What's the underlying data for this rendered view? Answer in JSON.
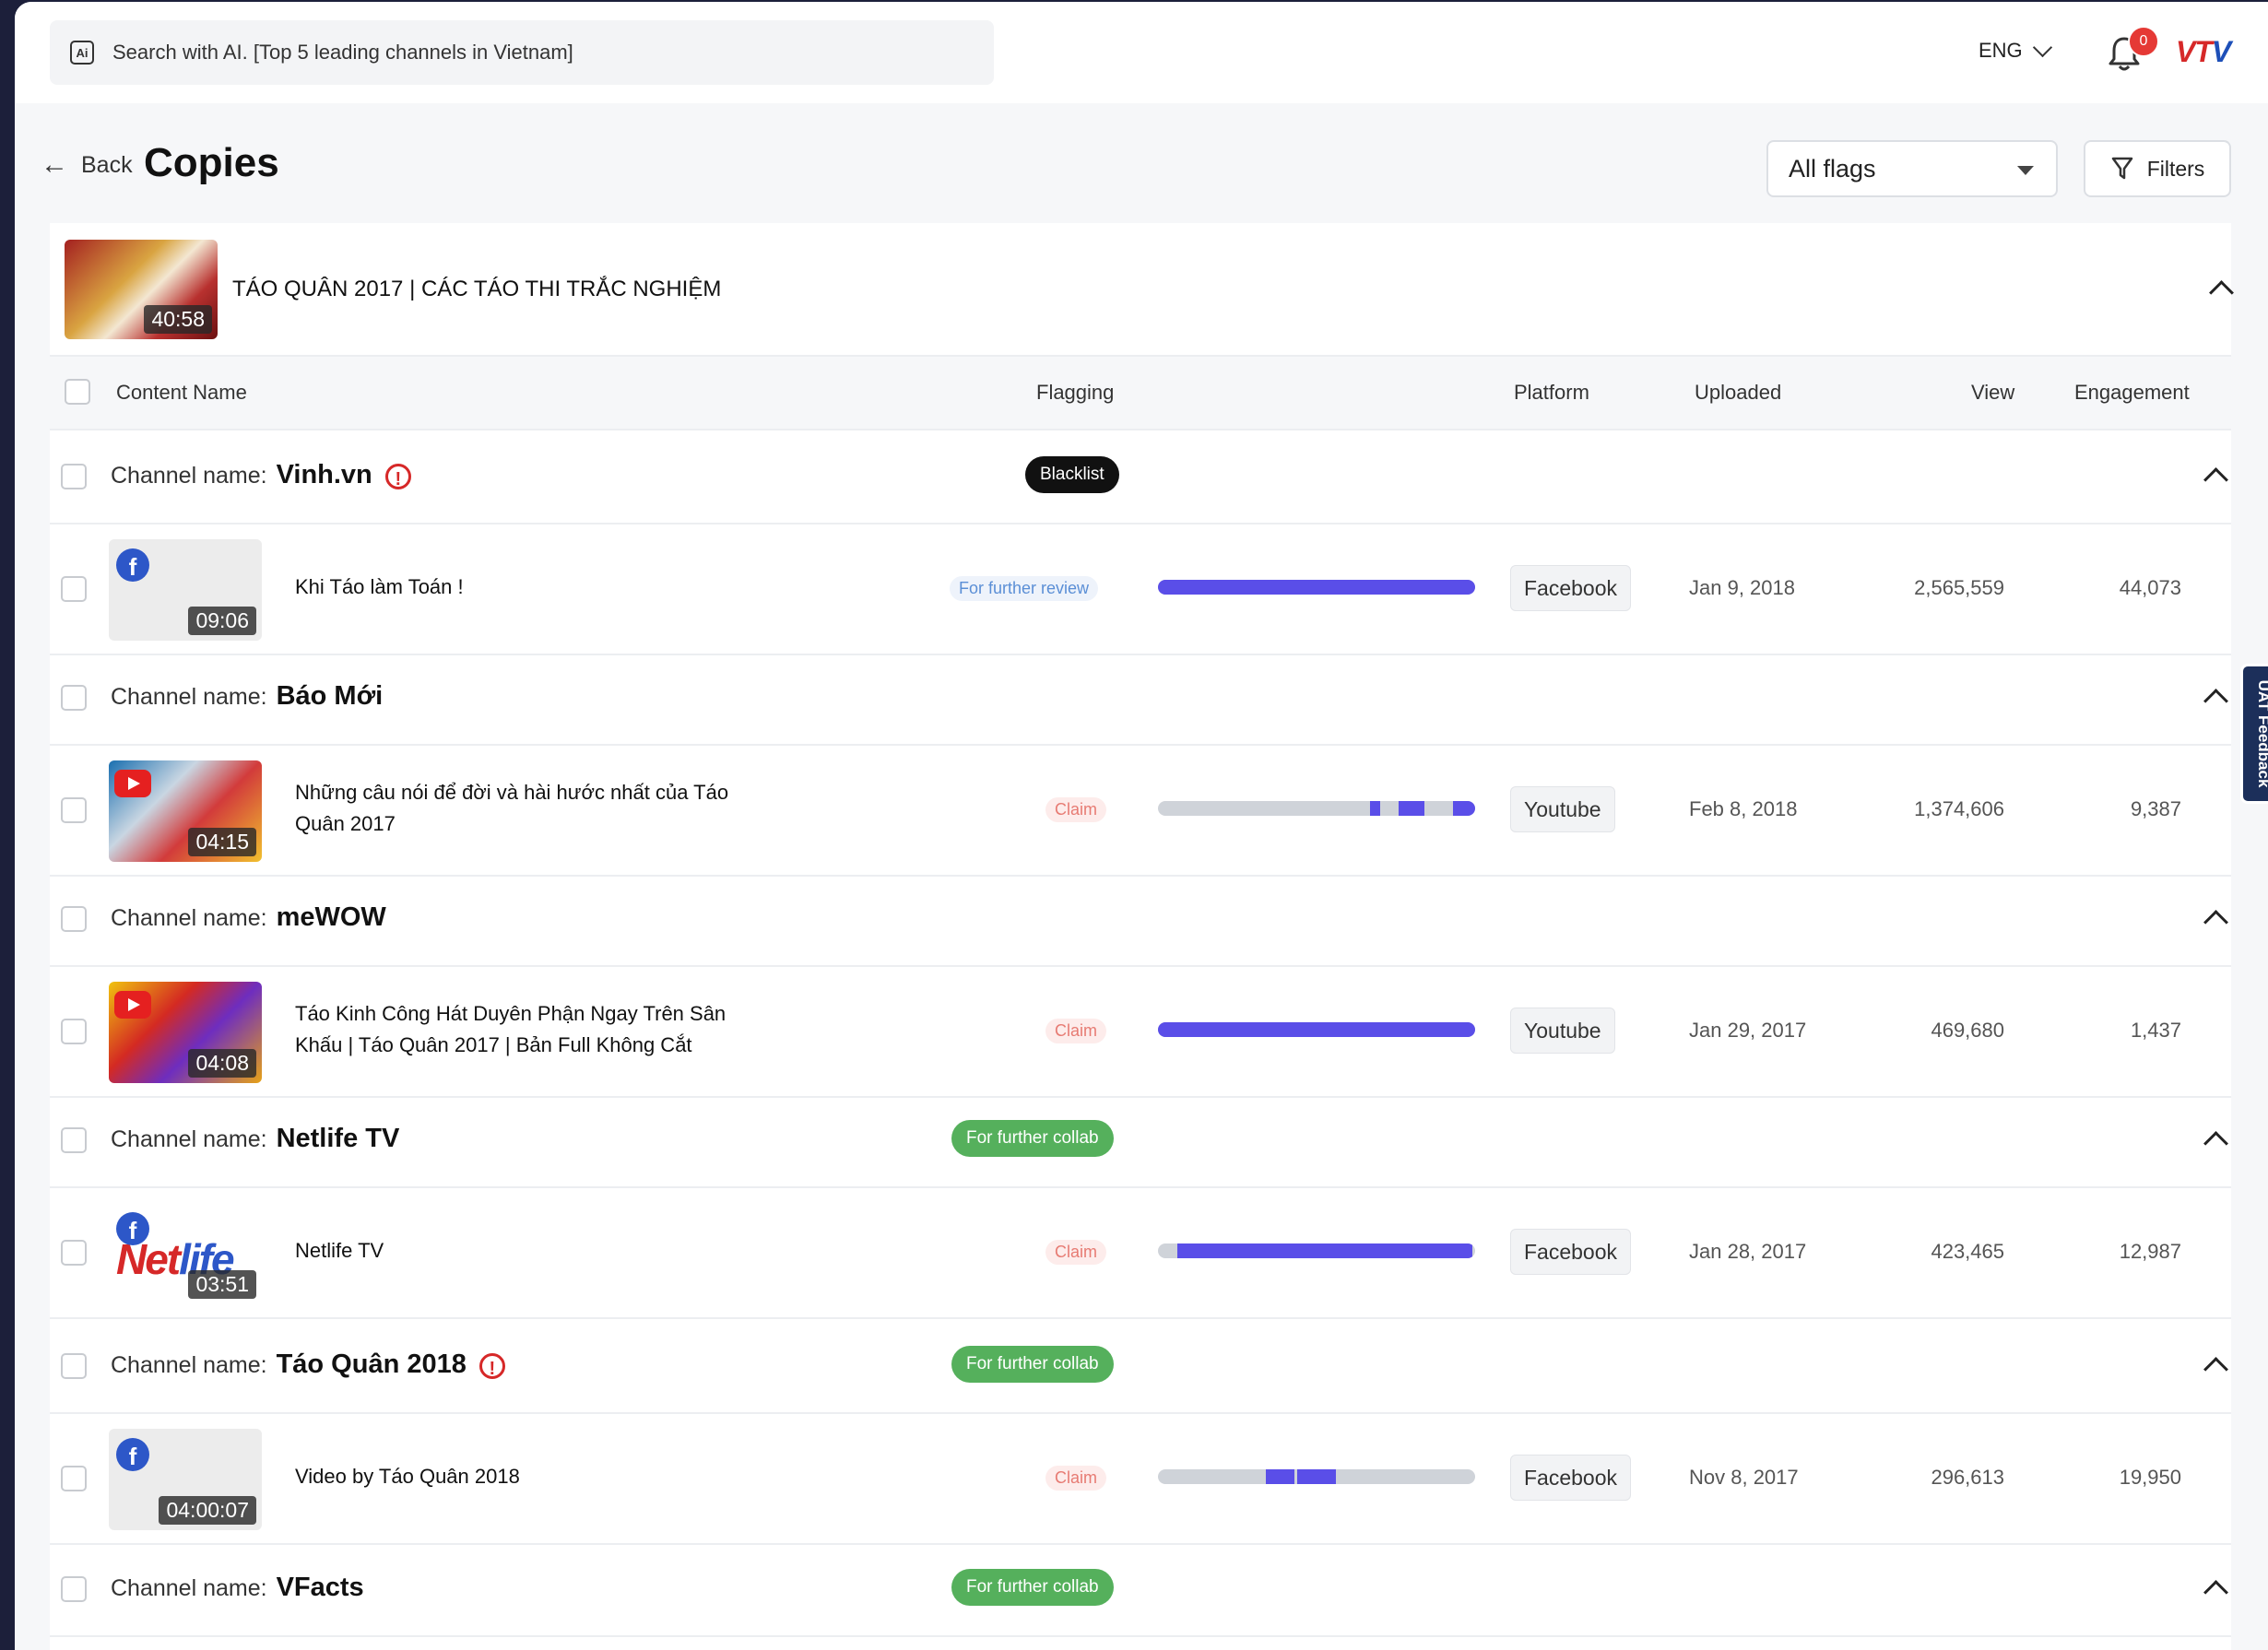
{
  "header": {
    "search_placeholder": "Search with AI. [Top 5 leading channels in Vietnam]",
    "ai_icon_text": "Ai",
    "language": "ENG",
    "notification_count": "0",
    "logo_part1": "VT",
    "logo_part2": "V"
  },
  "page": {
    "back_label": "Back",
    "title": "Copies",
    "flag_filter": "All flags",
    "filters_label": "Filters"
  },
  "source": {
    "title": "TÁO QUÂN 2017 | CÁC TÁO THI TRẮC NGHIỆM",
    "duration": "40:58"
  },
  "columns": {
    "content_name": "Content Name",
    "flagging": "Flagging",
    "platform": "Platform",
    "uploaded": "Uploaded",
    "view": "View",
    "engagement": "Engagement"
  },
  "channel_label": "Channel name:",
  "groups": [
    {
      "channel": "Vinh.vn",
      "warning": true,
      "channel_flag": "Blacklist",
      "flag_style": "black",
      "video": {
        "title": "Khi Táo làm Toán !",
        "title2": "",
        "duration": "09:06",
        "thumb": "fb",
        "status": "For further review",
        "status_style": "review",
        "match_segments": [
          [
            0.0,
            1.0
          ]
        ],
        "platform": "Facebook",
        "uploaded": "Jan 9, 2018",
        "views": "2,565,559",
        "engagement": "44,073"
      }
    },
    {
      "channel": "Báo Mới",
      "warning": false,
      "channel_flag": "",
      "flag_style": "",
      "video": {
        "title": "Những câu nói để đời và hài hước nhất của Táo",
        "title2": "Quân 2017",
        "duration": "04:15",
        "thumb": "yt1",
        "status": "Claim",
        "status_style": "claim",
        "match_segments": [
          [
            0.67,
            0.7
          ],
          [
            0.76,
            0.84
          ],
          [
            0.93,
            1.0
          ]
        ],
        "platform": "Youtube",
        "uploaded": "Feb 8, 2018",
        "views": "1,374,606",
        "engagement": "9,387"
      }
    },
    {
      "channel": "meWOW",
      "warning": false,
      "channel_flag": "",
      "flag_style": "",
      "video": {
        "title": "Táo Kinh Công Hát Duyên Phận Ngay Trên Sân",
        "title2": "Khấu | Táo Quân 2017 | Bản Full Không Cắt",
        "duration": "04:08",
        "thumb": "yt2",
        "status": "Claim",
        "status_style": "claim",
        "match_segments": [
          [
            0.0,
            1.0
          ]
        ],
        "platform": "Youtube",
        "uploaded": "Jan 29, 2017",
        "views": "469,680",
        "engagement": "1,437"
      }
    },
    {
      "channel": "Netlife TV",
      "warning": false,
      "channel_flag": "For further collab",
      "flag_style": "green",
      "video": {
        "title": "Netlife TV",
        "title2": "",
        "duration": "03:51",
        "thumb": "net",
        "status": "Claim",
        "status_style": "claim",
        "match_segments": [
          [
            0.06,
            0.99
          ]
        ],
        "platform": "Facebook",
        "uploaded": "Jan 28, 2017",
        "views": "423,465",
        "engagement": "12,987"
      }
    },
    {
      "channel": "Táo Quân 2018",
      "warning": true,
      "channel_flag": "For further collab",
      "flag_style": "green",
      "video": {
        "title": "Video by Táo Quân 2018",
        "title2": "",
        "duration": "04:00:07",
        "thumb": "fb",
        "status": "Claim",
        "status_style": "claim",
        "match_segments": [
          [
            0.34,
            0.43
          ],
          [
            0.44,
            0.56
          ]
        ],
        "platform": "Facebook",
        "uploaded": "Nov 8, 2017",
        "views": "296,613",
        "engagement": "19,950"
      }
    },
    {
      "channel": "VFacts",
      "warning": false,
      "channel_flag": "For further collab",
      "flag_style": "green",
      "video": null
    }
  ],
  "feedback_tab": "UAT Feedback",
  "netlife_logo": {
    "part1": "Net",
    "part2": "life"
  }
}
